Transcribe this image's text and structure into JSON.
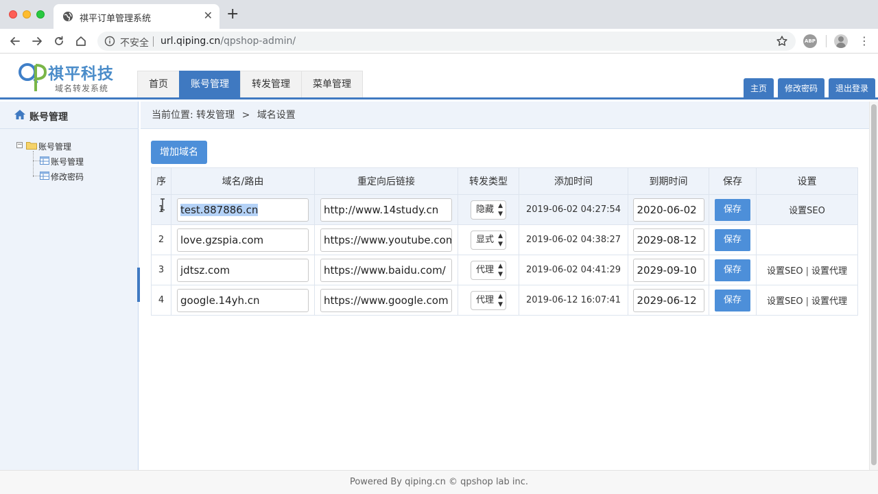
{
  "browser": {
    "tab_title": "祺平订单管理系统",
    "close": "✕",
    "new_tab": "+",
    "insecure_label": "不安全",
    "url_host": "url.qiping.cn",
    "url_path": "/qpshop-admin/",
    "abp": "ABP",
    "menu": "⋮"
  },
  "header": {
    "logo_name": "祺平科技",
    "logo_sub": "域名转发系统",
    "nav": [
      "首页",
      "账号管理",
      "转发管理",
      "菜单管理"
    ],
    "active_nav": "账号管理",
    "links": [
      "主页",
      "修改密码",
      "退出登录"
    ]
  },
  "sidebar": {
    "title": "账号管理",
    "tree_root": "账号管理",
    "tree_items": [
      "账号管理",
      "修改密码"
    ]
  },
  "content": {
    "breadcrumb_prefix": "当前位置:",
    "breadcrumb_items": [
      "转发管理",
      "域名设置"
    ],
    "breadcrumb_sep": ">",
    "add_button": "增加域名",
    "table": {
      "headers": [
        "序",
        "域名/路由",
        "重定向后链接",
        "转发类型",
        "添加时间",
        "到期时间",
        "保存",
        "设置"
      ],
      "rows": [
        {
          "no": "1",
          "domain": "test.887886.cn",
          "redirect": "http://www.14study.cn",
          "type": "隐藏",
          "added": "2019-06-02 04:27:54",
          "expires": "2020-06-02",
          "save": "保存",
          "settings": [
            "设置SEO"
          ]
        },
        {
          "no": "2",
          "domain": "love.gzspia.com",
          "redirect": "https://www.youtube.com",
          "type": "显式",
          "added": "2019-06-02 04:38:27",
          "expires": "2029-08-12",
          "save": "保存",
          "settings": []
        },
        {
          "no": "3",
          "domain": "jdtsz.com",
          "redirect": "https://www.baidu.com/",
          "type": "代理",
          "added": "2019-06-02 04:41:29",
          "expires": "2029-09-10",
          "save": "保存",
          "settings": [
            "设置SEO",
            "设置代理"
          ]
        },
        {
          "no": "4",
          "domain": "google.14yh.cn",
          "redirect": "https://www.google.com",
          "type": "代理",
          "added": "2019-06-12 16:07:41",
          "expires": "2029-06-12",
          "save": "保存",
          "settings": [
            "设置SEO",
            "设置代理"
          ]
        }
      ]
    }
  },
  "footer": {
    "text": "Powered By qiping.cn © qpshop lab inc."
  },
  "colors": {
    "accent": "#3f79c1",
    "button": "#4d8fd9",
    "panel": "#eef3fa"
  }
}
